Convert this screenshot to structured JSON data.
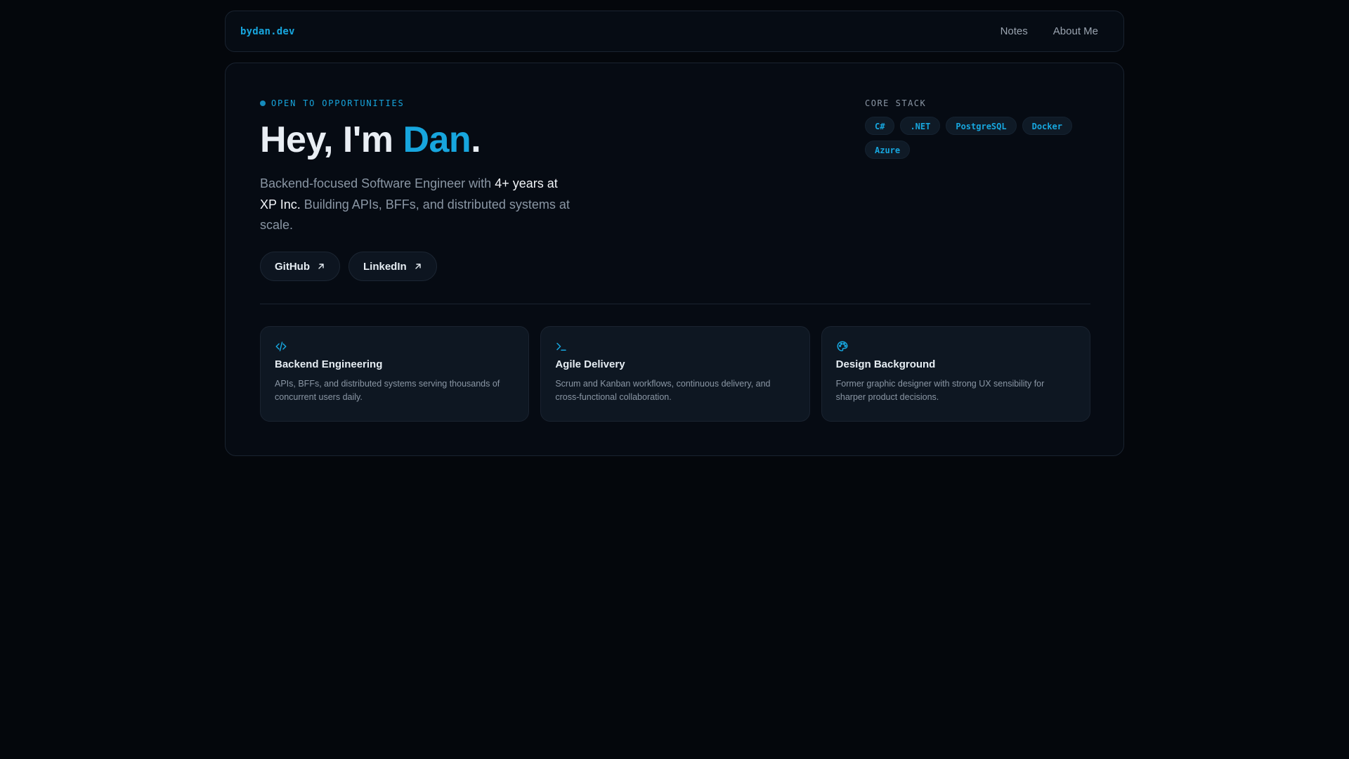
{
  "nav": {
    "brand": "bydan.dev",
    "links": [
      {
        "label": "Notes"
      },
      {
        "label": "About Me"
      }
    ]
  },
  "hero": {
    "status": "OPEN TO OPPORTUNITIES",
    "title_prefix": "Hey, I'm ",
    "title_name": "Dan",
    "title_suffix": ".",
    "bio": {
      "part1": "Backend-focused Software Engineer with ",
      "highlight": "4+ years at XP Inc.",
      "part2": " Building APIs, BFFs, and distributed systems at scale."
    },
    "buttons": [
      {
        "label": "GitHub",
        "icon": "arrow-up-right-icon"
      },
      {
        "label": "LinkedIn",
        "icon": "arrow-up-right-icon"
      }
    ]
  },
  "stack": {
    "label": "CORE STACK",
    "items": [
      "C#",
      ".NET",
      "PostgreSQL",
      "Docker",
      "Azure"
    ]
  },
  "cards": [
    {
      "icon": "code-icon",
      "title": "Backend Engineering",
      "desc": "APIs, BFFs, and distributed systems serving thousands of concurrent users daily."
    },
    {
      "icon": "terminal-icon",
      "title": "Agile Delivery",
      "desc": "Scrum and Kanban workflows, continuous delivery, and cross-functional collaboration."
    },
    {
      "icon": "palette-icon",
      "title": "Design Background",
      "desc": "Former graphic designer with strong UX sensibility for sharper product decisions."
    }
  ],
  "colors": {
    "background": "#04070c",
    "accent": "#17a6de",
    "surface": "#0e1722",
    "muted_text": "#8a96a4"
  }
}
